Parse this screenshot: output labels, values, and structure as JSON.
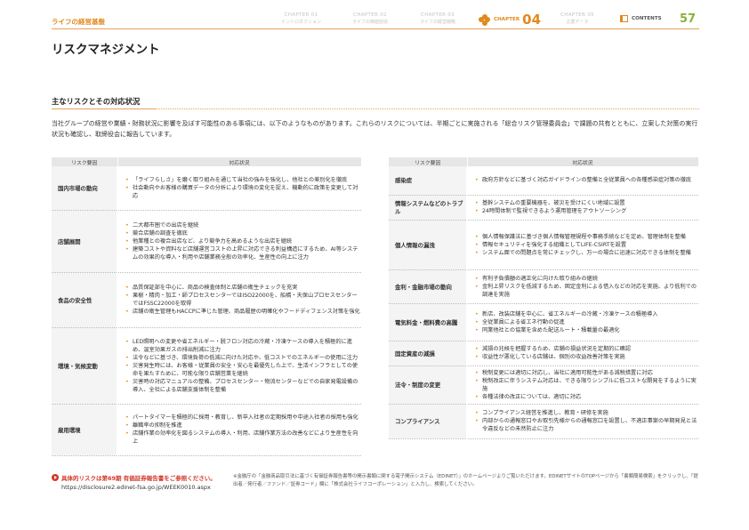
{
  "header": {
    "section_label": "ライフの経営基盤",
    "chapters": [
      {
        "num": "CHAPTER 01",
        "name": "イントロダクション"
      },
      {
        "num": "CHAPTER 02",
        "name": "ライフの価値創造"
      },
      {
        "num": "CHAPTER 03",
        "name": "ライフの経営戦略"
      }
    ],
    "active_chapter": {
      "label": "CHAPTER",
      "num": "04"
    },
    "chapter05": {
      "num": "CHAPTER 05",
      "name": "企業データ"
    },
    "contents_label": "CONTENTS",
    "page_number": "57",
    "accent_color": "#e08a1e"
  },
  "page_title": "リスクマネジメント",
  "section": {
    "heading": "主なリスクとその対応状況",
    "intro": "当社グループの経営や業績・財務状況に影響を及ぼす可能性のある事項には、以下のようなものがあります。これらのリスクについては、半期ごとに実施される「総合リスク管理委員会」で課題の共有とともに、立案した対策の実行状況も確認し、取締役会に報告しています。"
  },
  "table_headers": {
    "risk": "リスク要因",
    "measures": "対応状況"
  },
  "left_rows": [
    {
      "category": "国内市場の動向",
      "items": [
        "「ライフらしさ」を磨く取り組みを通じて当社の強みを強化し、他社との差別化を徹底",
        "社会動向やお客様の購買データの分析により環境の変化を捉え、機動的に政策を変更して対応"
      ]
    },
    {
      "category": "店舗展開",
      "items": [
        "二大都市圏での出店を継続",
        "競合店舗の調査を徹底",
        "他業種との複合出店など、より競争力を高めるような出店を継続",
        "建築コストや資料など店舗運営コストの上昇に対応できる利益構造にするため、AI等システムの効果的な導入・利用や店舗業務全般の効率化、生産性の向上に注力"
      ]
    },
    {
      "category": "食品の安全性",
      "items": [
        "品質保証部を中心に、商品の検査体制と店舗の衛生チェックを充実",
        "果樹・精肉・加工・師プロセスセンターではISO22000を、船橋・天保山プロセスセンターではFSSC22000を取得",
        "店舗の衛生管理もHACCPに準じた管理、商品履歴の明確化やフードディフェンス対策を強化"
      ]
    },
    {
      "category": "環境・気候変動",
      "items": [
        "LED照明への変更や省エネルギー・脱フロン対応の冷蔵・冷凍ケースの導入を積極的に進め、温室効果ガスの排出削減に注力",
        "法令などに基づき、環境負荷の低減に向けた対応や、低コストでのエネルギーの使用に注力",
        "災害発生時には、お客様・従業員の安全・安心を最優先した上で、生活インフラとしての使命を果たすために、可能な限り店舗営業を継続",
        "災害時の対応マニュアルの整備、プロセスセンター・物流センターなどでの自家発電設備の導入、全社による店舗支援体制を整備"
      ]
    },
    {
      "category": "雇用環境",
      "items": [
        "パートタイマーを積極的に採用・教育し、新卒入社者の定期採用や中途入社者の採用も強化",
        "離職率の抑制を推進",
        "店舗作業の効率化を図るシステムの導入・利用、店舗作業方法の改善などにより生産性を向上"
      ]
    }
  ],
  "right_rows": [
    {
      "category": "感染症",
      "items": [
        "政府方針などに基づく対応ガイドラインの整備と全従業員への各種感染症対策の徹底"
      ]
    },
    {
      "category": "情報システムなどのトラブル",
      "items": [
        "基幹システムの重要機器を、被災を受けにくい地域に設置",
        "24時間体制で監視できるよう運用管理をアウトソーシング"
      ]
    },
    {
      "category": "個人情報の漏洩",
      "items": [
        "個人情報保護法に基づき個人情報管理規程や事務手続などを定め、管理体制を整備",
        "情報セキュリティを強化する組織としてLIFE-CSIRTを設置",
        "システム面での問題点を常にチェックし、万一の場合に迅速に対応できる体制を整備"
      ]
    },
    {
      "category": "金利・金融市場の動向",
      "items": [
        "有利子負債額の適正化に向けた取り組みの継続",
        "金利上昇リスクを低減するため、固定金利による借入などの対応を実施、より低利での調達を実施"
      ]
    },
    {
      "category": "電気料金・燃料費の高騰",
      "items": [
        "新店、改装店舗を中心に、省エネルギーの冷蔵・冷凍ケースの積極導入",
        "全従業員による省エネ行動の促進",
        "同業他社との協業を含めた配送ルート・積載量の最適化"
      ]
    },
    {
      "category": "固定資産の減損",
      "items": [
        "減損の兆候を把握するため、店舗の損益状況を定期的に確認",
        "収益性が悪化している店舗は、個別の収益改善対策を実施"
      ]
    },
    {
      "category": "法令・制度の変更",
      "items": [
        "税制変更には適切に対応し、当社に適用可能性がある減税措置に対応",
        "税制改正に伴うシステム対応は、できる限りシンプルに低コストな開発をするように実施",
        "各種法律の改正については、適切に対応"
      ]
    },
    {
      "category": "コンプライアンス",
      "items": [
        "コンプライアンス経営を推進し、教育・研修を実施",
        "内部からの通報窓口やお取引先様からの通報窓口を設置し、不適正事案の早期発見と法令違反などの未然防止に注力"
      ]
    }
  ],
  "footer": {
    "red_note": "具体的リスクは第69期 有価証券報告書をご参照ください。",
    "url": "https://disclosure2.edinet-fsa.go.jp/WEEK0010.aspx",
    "note": "※金融庁の「金融商品取引法に基づく有価証券報告書等の開示書類に関する電子開示システム（EDINET）」のホームページよりご覧いただけます。EDINETサイトのTOPページから「書類簡易検索」をクリックし、「提出者／発行者／ファンド／証券コード」欄に「株式会社ライフコーポレーション」と入力し、検索してください。"
  }
}
